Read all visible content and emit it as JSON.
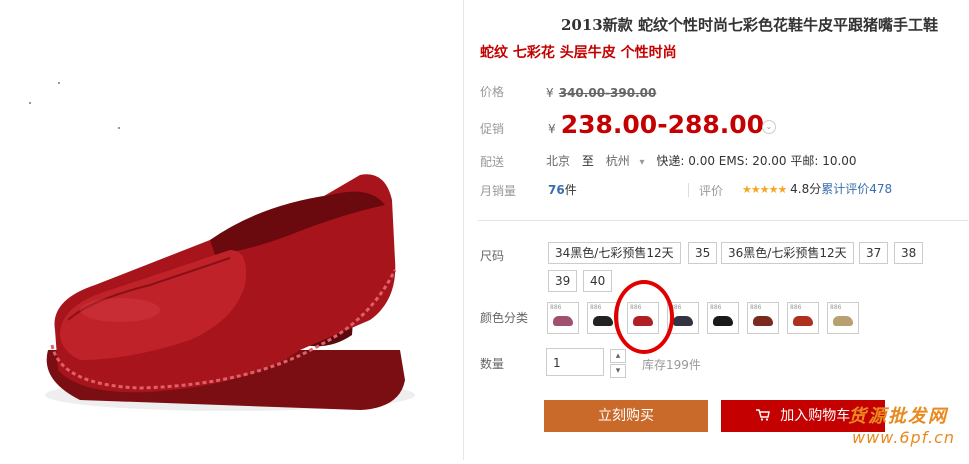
{
  "product": {
    "title": "2013新款 蛇纹个性时尚七彩色花鞋牛皮平跟猪嘴手工鞋",
    "subtitle": "蛇纹 七彩花 头层牛皮 个性时尚"
  },
  "price": {
    "original_label": "价格",
    "currency": "¥",
    "original_value": "340.00-390.00",
    "promo_label": "促销",
    "promo_value": "238.00-288.00"
  },
  "shipping": {
    "label": "配送",
    "from": "北京",
    "to_word": "至",
    "to": "杭州",
    "fees": "快递: 0.00 EMS: 20.00 平邮: 10.00"
  },
  "sales": {
    "label": "月销量",
    "count": "76",
    "unit": "件",
    "rating_label": "评价",
    "stars": "★★★★★",
    "score": "4.8分",
    "cumulative": "累计评价478"
  },
  "sizes": {
    "label": "尺码",
    "row1": [
      "34黑色/七彩预售12天",
      "35",
      "36黑色/七彩预售12天",
      "37",
      "38"
    ],
    "row2": [
      "39",
      "40"
    ]
  },
  "colors": {
    "label": "颜色分类",
    "swatch_tag": "886",
    "swatches": [
      "#a05070",
      "#222222",
      "#b01f24",
      "#333344",
      "#1a1a1a",
      "#7a2a20",
      "#b03020",
      "#b8a070"
    ]
  },
  "quantity": {
    "label": "数量",
    "value": "1",
    "up": "▴",
    "down": "▾",
    "stock": "库存199件"
  },
  "actions": {
    "buy": "立刻购买",
    "cart": "加入购物车"
  },
  "watermark": {
    "line1": "货源批发网",
    "line2": "www.6pf.cn"
  },
  "icons": {
    "chevron": "⌄",
    "cart": "🛒",
    "dropdown": "▾"
  },
  "accent_colors": {
    "price_red": "#c40000",
    "buy_orange": "#c96a2a",
    "link_blue": "#3a6fae"
  }
}
